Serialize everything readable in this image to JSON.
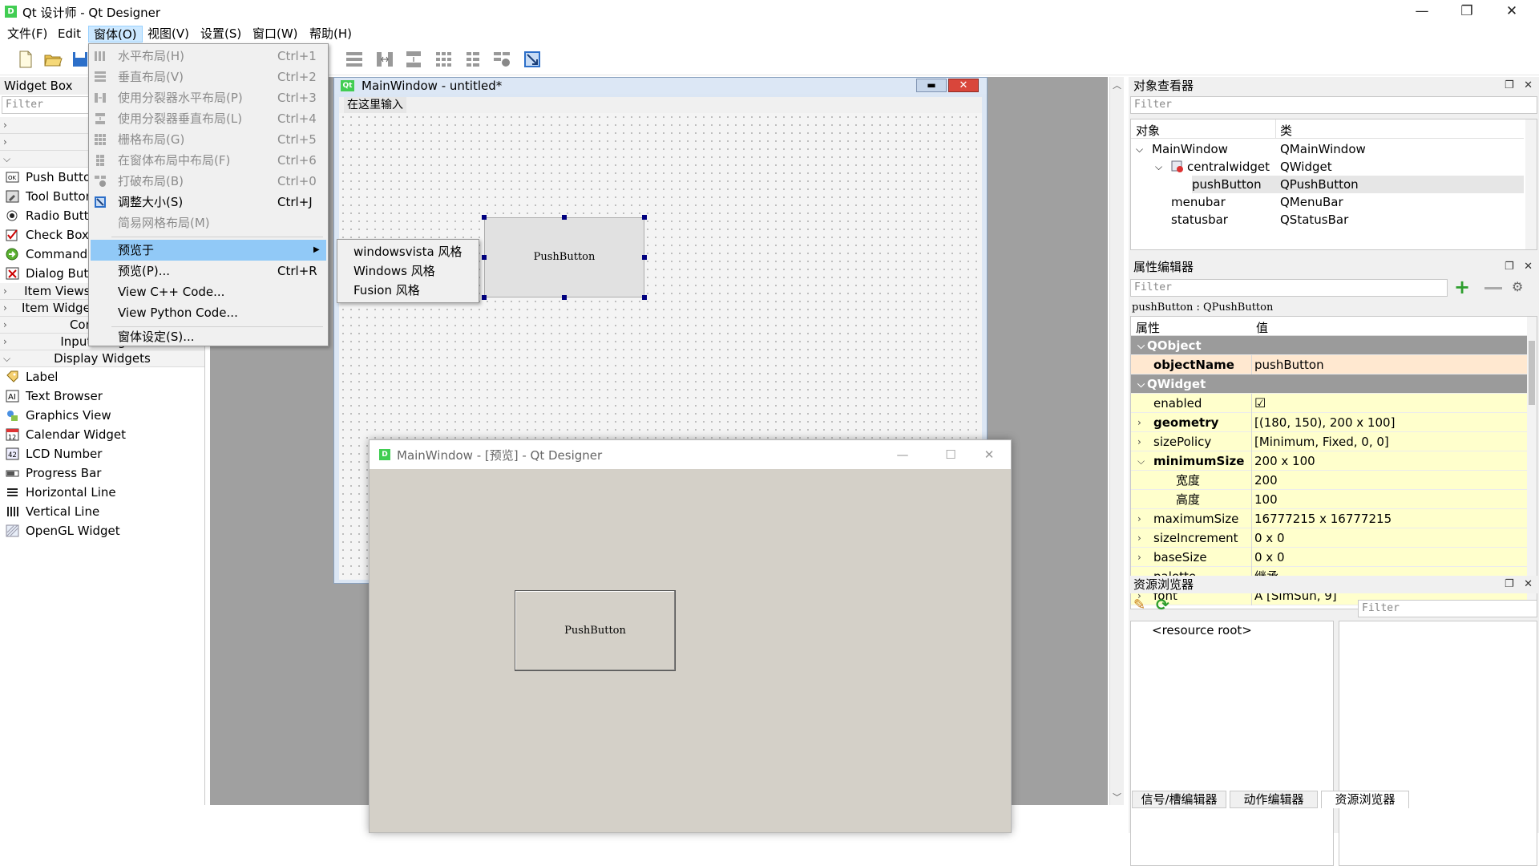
{
  "app": {
    "title": "Qt 设计师 - Qt Designer",
    "logo_text": "D",
    "window_controls": [
      "—",
      "❐",
      "✕"
    ]
  },
  "menubar": [
    {
      "label": "文件(F)"
    },
    {
      "label": "Edit"
    },
    {
      "label": "窗体(O)",
      "active": true
    },
    {
      "label": "视图(V)"
    },
    {
      "label": "设置(S)"
    },
    {
      "label": "窗口(W)"
    },
    {
      "label": "帮助(H)"
    }
  ],
  "form_menu": [
    {
      "label": "水平布局(H)",
      "shortcut": "Ctrl+1",
      "disabled": true,
      "icon": "horizontal-layout-icon"
    },
    {
      "label": "垂直布局(V)",
      "shortcut": "Ctrl+2",
      "disabled": true,
      "icon": "vertical-layout-icon"
    },
    {
      "label": "使用分裂器水平布局(P)",
      "shortcut": "Ctrl+3",
      "disabled": true,
      "icon": "hsplitter-icon"
    },
    {
      "label": "使用分裂器垂直布局(L)",
      "shortcut": "Ctrl+4",
      "disabled": true,
      "icon": "vsplitter-icon"
    },
    {
      "label": "栅格布局(G)",
      "shortcut": "Ctrl+5",
      "disabled": true,
      "icon": "grid-layout-icon"
    },
    {
      "label": "在窗体布局中布局(F)",
      "shortcut": "Ctrl+6",
      "disabled": true,
      "icon": "form-layout-icon"
    },
    {
      "label": "打破布局(B)",
      "shortcut": "Ctrl+0",
      "disabled": true,
      "icon": "break-layout-icon"
    },
    {
      "label": "调整大小(S)",
      "shortcut": "Ctrl+J",
      "disabled": false,
      "icon": "adjust-size-icon"
    },
    {
      "label": "简易网格布局(M)",
      "shortcut": "",
      "disabled": true,
      "icon": ""
    },
    {
      "label": "预览于",
      "shortcut": "",
      "disabled": false,
      "highlight": true,
      "submenu": true
    },
    {
      "label": "预览(P)...",
      "shortcut": "Ctrl+R",
      "disabled": false
    },
    {
      "label": "View C++ Code...",
      "shortcut": "",
      "disabled": false
    },
    {
      "label": "View Python Code...",
      "shortcut": "",
      "disabled": false
    },
    {
      "label": "窗体设定(S)...",
      "shortcut": "",
      "disabled": false
    }
  ],
  "preview_submenu": [
    "windowsvista 风格",
    "Windows 风格",
    "Fusion 风格"
  ],
  "widget_box": {
    "title": "Widget Box",
    "filter_placeholder": "Filter",
    "button_items": [
      "Push Button",
      "Tool Button",
      "Radio Button",
      "Check Box",
      "Command Link Button",
      "Dialog Button Box"
    ],
    "categories_top": [
      "",
      "",
      ""
    ],
    "categories_mid": [
      "Item Views (Model-Based)",
      "Item Widgets (Item-Based)",
      "Containers"
    ],
    "input_widgets": "Input Widgets",
    "display_widgets": "Display Widgets",
    "display_items": [
      "Label",
      "Text Browser",
      "Graphics View",
      "Calendar Widget",
      "LCD Number",
      "Progress Bar",
      "Horizontal Line",
      "Vertical Line",
      "OpenGL Widget"
    ]
  },
  "form_window": {
    "title": "MainWindow - untitled*",
    "qt_badge": "Qt",
    "menu_placeholder": "在这里输入",
    "button_text": "PushButton"
  },
  "preview_window": {
    "title": "MainWindow - [预览] - Qt Designer",
    "button_text": "PushButton"
  },
  "object_inspector": {
    "title": "对象查看器",
    "filter_placeholder": "Filter",
    "col_object": "对象",
    "col_class": "类",
    "rows": [
      {
        "name": "MainWindow",
        "cls": "QMainWindow",
        "level": 0,
        "expander": "⌵"
      },
      {
        "name": "centralwidget",
        "cls": "QWidget",
        "level": 1,
        "expander": "⌵"
      },
      {
        "name": "pushButton",
        "cls": "QPushButton",
        "level": 2,
        "expander": "",
        "selected": true
      },
      {
        "name": "menubar",
        "cls": "QMenuBar",
        "level": 1,
        "expander": ""
      },
      {
        "name": "statusbar",
        "cls": "QStatusBar",
        "level": 1,
        "expander": ""
      }
    ]
  },
  "property_editor": {
    "title": "属性编辑器",
    "filter_placeholder": "Filter",
    "context": "pushButton : QPushButton",
    "col_property": "属性",
    "col_value": "值",
    "rows": [
      {
        "name": "QObject",
        "value": "",
        "type": "group"
      },
      {
        "name": "objectName",
        "value": "pushButton",
        "type": "org",
        "bold": true
      },
      {
        "name": "QWidget",
        "value": "",
        "type": "group"
      },
      {
        "name": "enabled",
        "value": "☑",
        "type": "yel"
      },
      {
        "name": "geometry",
        "value": "[(180, 150), 200 x 100]",
        "type": "yel",
        "bold": true,
        "expander": "›"
      },
      {
        "name": "sizePolicy",
        "value": "[Minimum, Fixed, 0, 0]",
        "type": "yel",
        "expander": "›"
      },
      {
        "name": "minimumSize",
        "value": "200 x 100",
        "type": "yel",
        "bold": true,
        "expander": "⌵"
      },
      {
        "name": "宽度",
        "value": "200",
        "type": "yel",
        "indent": true
      },
      {
        "name": "高度",
        "value": "100",
        "type": "yel",
        "indent": true
      },
      {
        "name": "maximumSize",
        "value": "16777215 x 16777215",
        "type": "yel",
        "expander": "›"
      },
      {
        "name": "sizeIncrement",
        "value": "0 x 0",
        "type": "yel",
        "expander": "›"
      },
      {
        "name": "baseSize",
        "value": "0 x 0",
        "type": "yel",
        "expander": "›"
      },
      {
        "name": "palette",
        "value": "继承",
        "type": "yel"
      },
      {
        "name": "font",
        "value": "A  [SimSun, 9]",
        "type": "yel",
        "expander": "›"
      }
    ]
  },
  "resource_browser": {
    "title": "资源浏览器",
    "filter_placeholder": "Filter",
    "root": "<resource root>"
  },
  "bottom_tabs": [
    "信号/槽编辑器",
    "动作编辑器",
    "资源浏览器"
  ],
  "colors": {
    "accent": "#91c9f7",
    "group_header": "#9b9b9b",
    "property_yellow": "#ffffcc",
    "handle": "#00007f",
    "qt_green": "#41cd52"
  }
}
